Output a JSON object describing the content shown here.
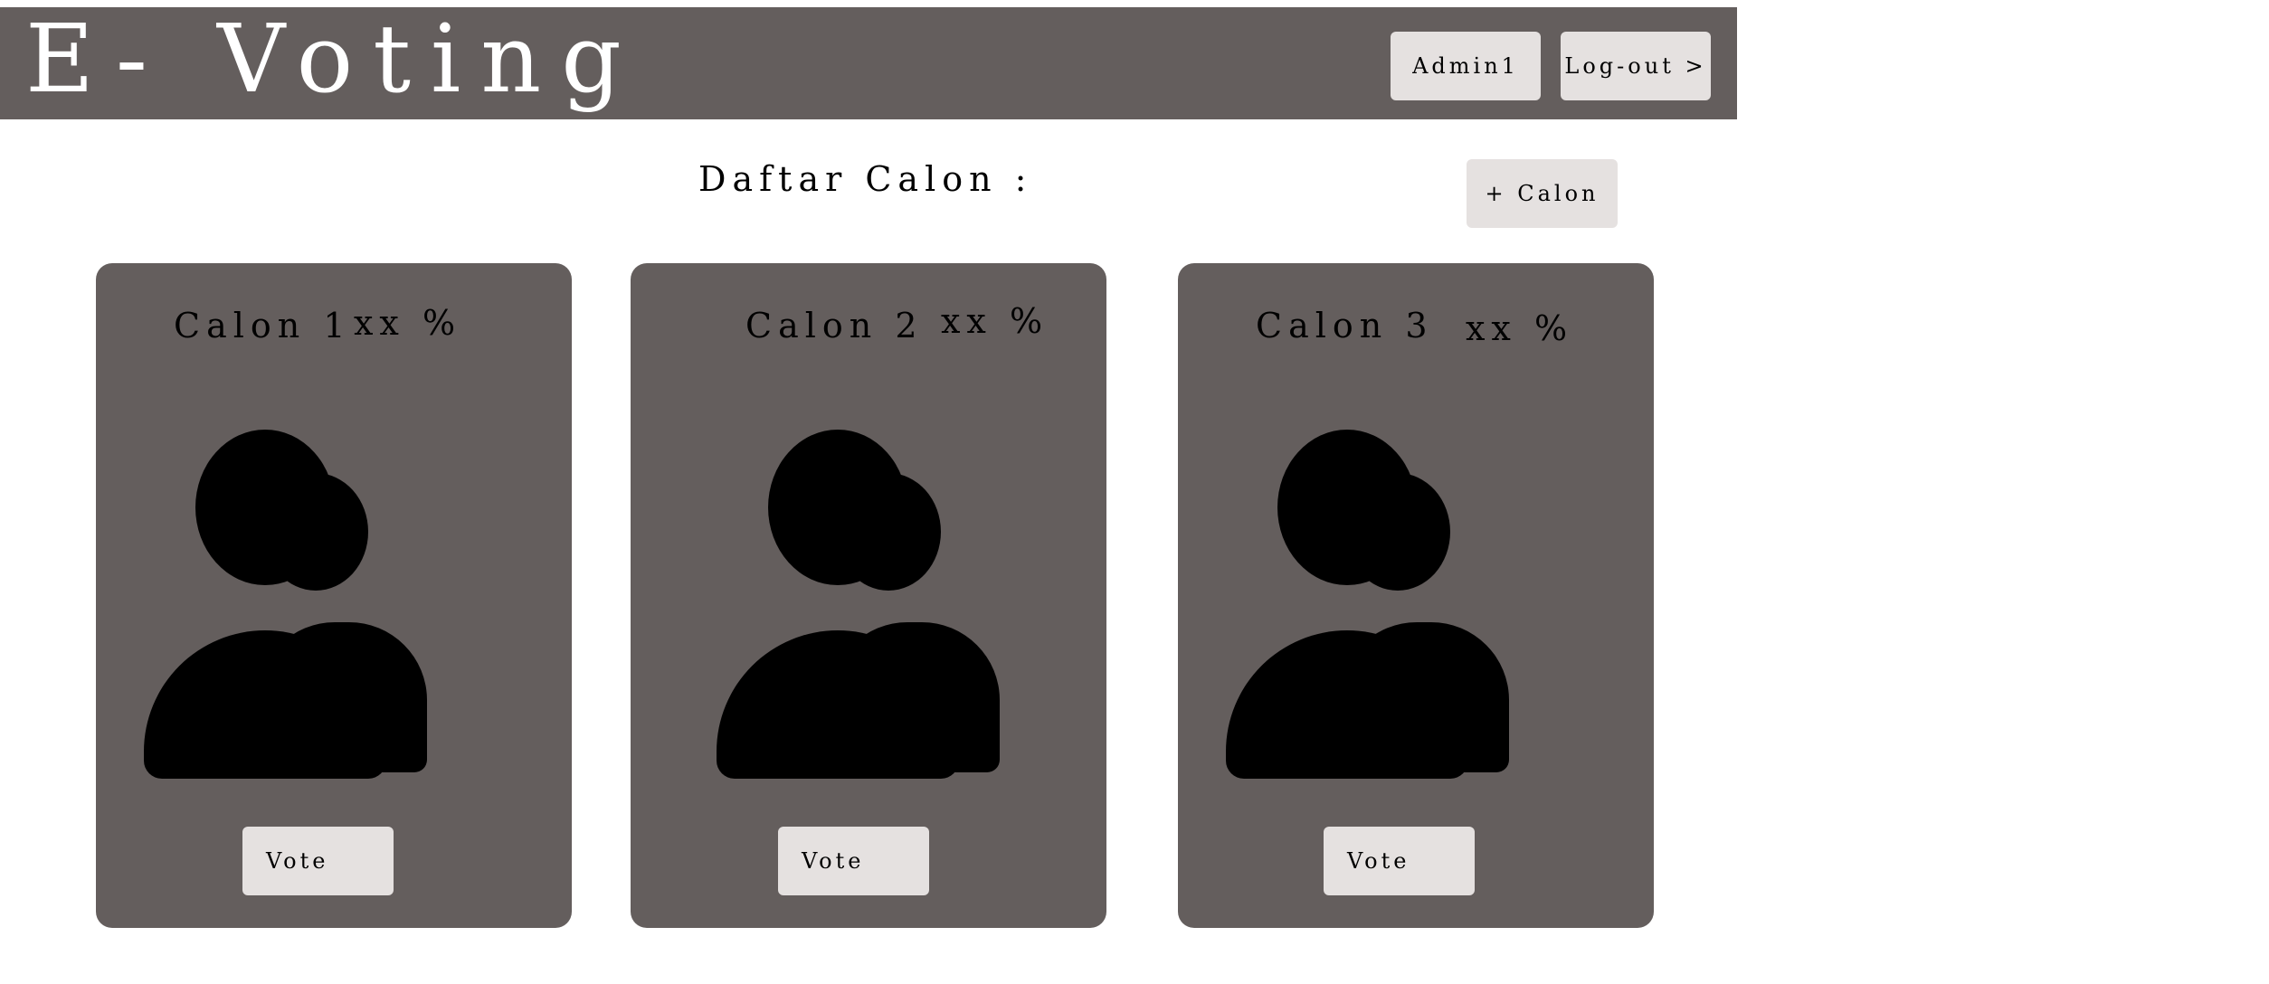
{
  "header": {
    "title": "E- Voting",
    "admin_label": "Admin1",
    "logout_label": "Log-out >"
  },
  "main": {
    "section_title": "Daftar Calon :",
    "add_candidate_label": "+ Calon",
    "candidates": [
      {
        "name": "Calon 1",
        "percent": "xx %",
        "vote_label": "Vote",
        "icon": "users-icon"
      },
      {
        "name": "Calon 2",
        "percent": "xx %",
        "vote_label": "Vote",
        "icon": "users-icon"
      },
      {
        "name": "Calon 3",
        "percent": "xx %",
        "vote_label": "Vote",
        "icon": "users-icon"
      }
    ]
  },
  "colors": {
    "header_bg": "#645e5d",
    "card_bg": "#645e5d",
    "button_bg": "#e5e1e0",
    "title_text": "#ffffff",
    "icon": "#000000"
  }
}
